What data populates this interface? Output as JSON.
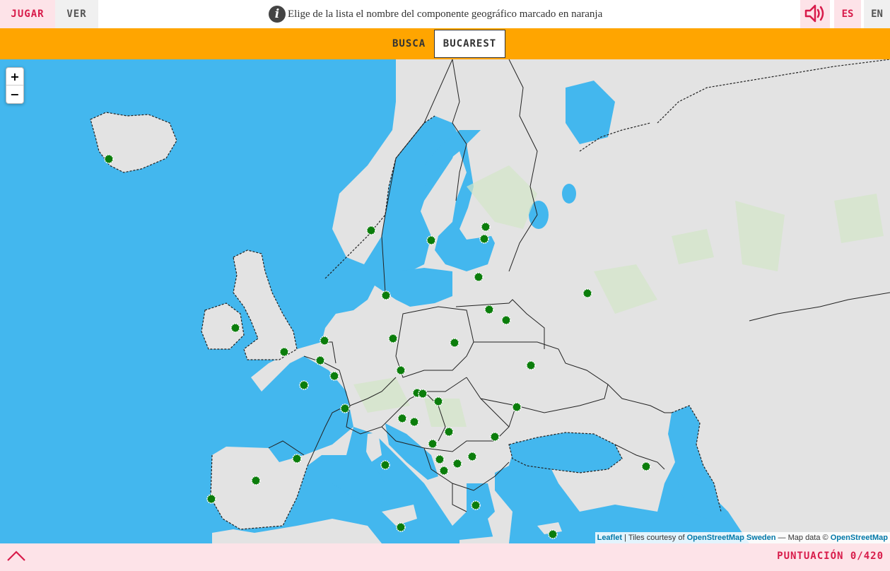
{
  "toolbar": {
    "play_label": "JUGAR",
    "view_label": "VER",
    "instruction": "Elige de la lista el nombre del componente geográfico marcado en naranja",
    "info_icon": "info-icon",
    "sound_icon": "speaker-icon",
    "lang_es": "ES",
    "lang_en": "EN"
  },
  "search": {
    "label": "BUSCA",
    "target": "BUCAREST"
  },
  "map": {
    "zoom_in": "+",
    "zoom_out": "−",
    "attribution": {
      "leaflet": "Leaflet",
      "tiles_text": " | Tiles courtesy of ",
      "osm_sweden": "OpenStreetMap Sweden",
      "data_text": " — Map data © ",
      "osm": "OpenStreetMap"
    },
    "marker_color": "#0b7d0b",
    "water_color": "#43b7ee",
    "land_color": "#e3e3e3"
  },
  "footer": {
    "collapse_icon": "chevron-up-icon",
    "score": "PUNTUACIÓN 0/420"
  }
}
